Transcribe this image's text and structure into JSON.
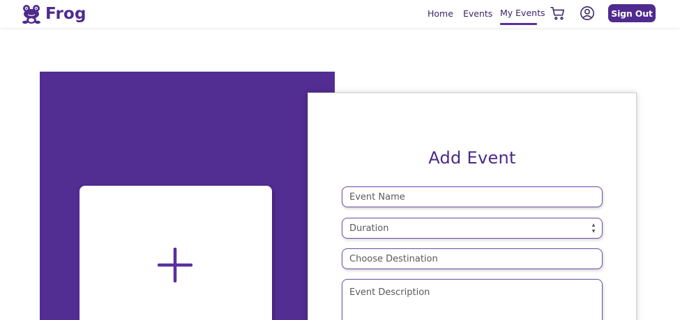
{
  "header": {
    "brand_name": "Frog",
    "brand_logo_icon": "frog-logo-icon",
    "nav": {
      "home": "Home",
      "events": "Events",
      "my_events": "My Events"
    },
    "cart_icon": "cart-icon",
    "profile_icon": "user-profile-icon",
    "sign_out": "Sign Out"
  },
  "upload": {
    "icon": "plus-icon"
  },
  "form": {
    "title": "Add Event",
    "event_name_placeholder": "Event Name",
    "duration_placeholder": "Duration",
    "destination_placeholder": "Choose Destination",
    "description_placeholder": "Event Description"
  },
  "colors": {
    "brand_purple": "#4f2a8f",
    "panel_purple": "#522d92",
    "white": "#ffffff"
  }
}
